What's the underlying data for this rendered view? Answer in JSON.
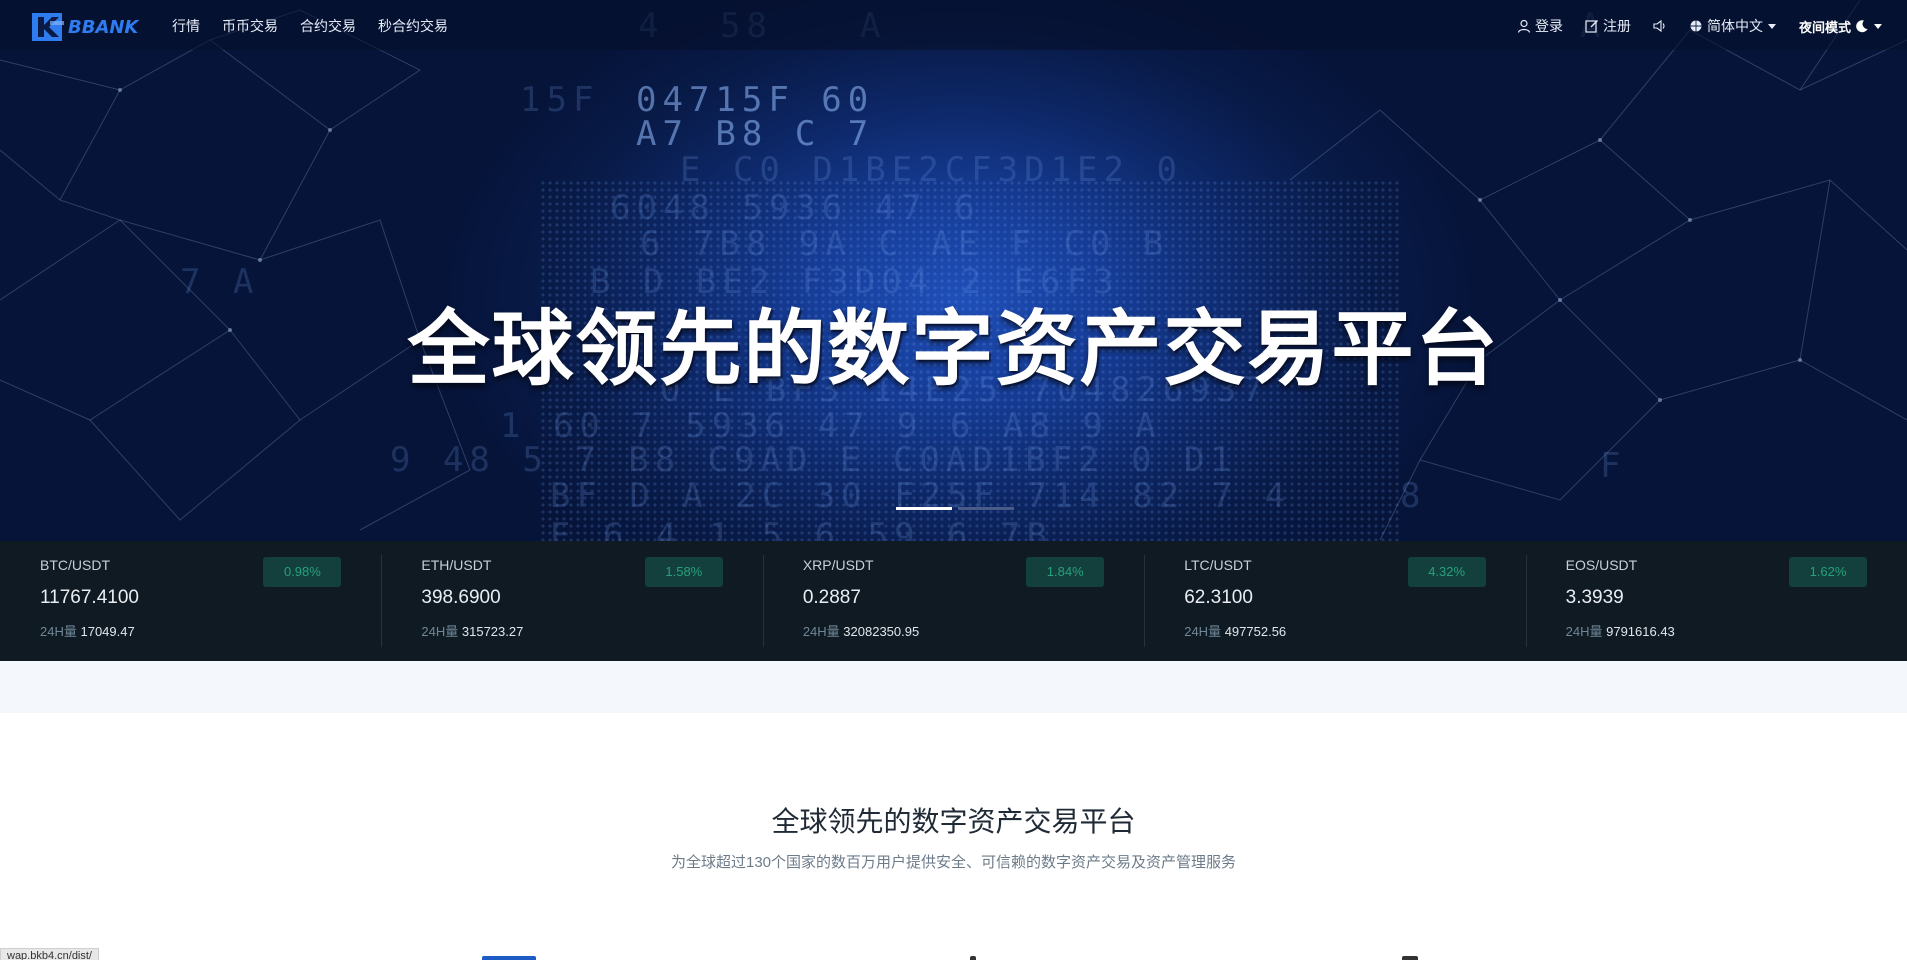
{
  "brand": {
    "name": "BBANK",
    "accent": "#2f7cf0"
  },
  "nav": {
    "links": [
      "行情",
      "币币交易",
      "合约交易",
      "秒合约交易"
    ],
    "login": "登录",
    "register": "注册",
    "language": "简体中文",
    "night_mode": "夜间模式"
  },
  "hero": {
    "title": "全球领先的数字资产交易平台",
    "slides": 2,
    "active_slide": 1
  },
  "tickers": [
    {
      "pair": "BTC/USDT",
      "change": "0.98%",
      "price": "11767.4100",
      "vol_label": "24H量",
      "volume": "17049.47"
    },
    {
      "pair": "ETH/USDT",
      "change": "1.58%",
      "price": "398.6900",
      "vol_label": "24H量",
      "volume": "315723.27"
    },
    {
      "pair": "XRP/USDT",
      "change": "1.84%",
      "price": "0.2887",
      "vol_label": "24H量",
      "volume": "32082350.95"
    },
    {
      "pair": "LTC/USDT",
      "change": "4.32%",
      "price": "62.3100",
      "vol_label": "24H量",
      "volume": "497752.56"
    },
    {
      "pair": "EOS/USDT",
      "change": "1.62%",
      "price": "3.3939",
      "vol_label": "24H量",
      "volume": "9791616.43"
    }
  ],
  "section": {
    "title": "全球领先的数字资产交易平台",
    "subtitle": "为全球超过130个国家的数百万用户提供安全、可信赖的数字资产交易及资产管理服务"
  },
  "status_bar": {
    "url": "wap.bkb4.cn/dist/"
  },
  "colors": {
    "ticker_bg": "#0f1a22",
    "up": "#26a17b",
    "hero_dark": "#06143a"
  }
}
